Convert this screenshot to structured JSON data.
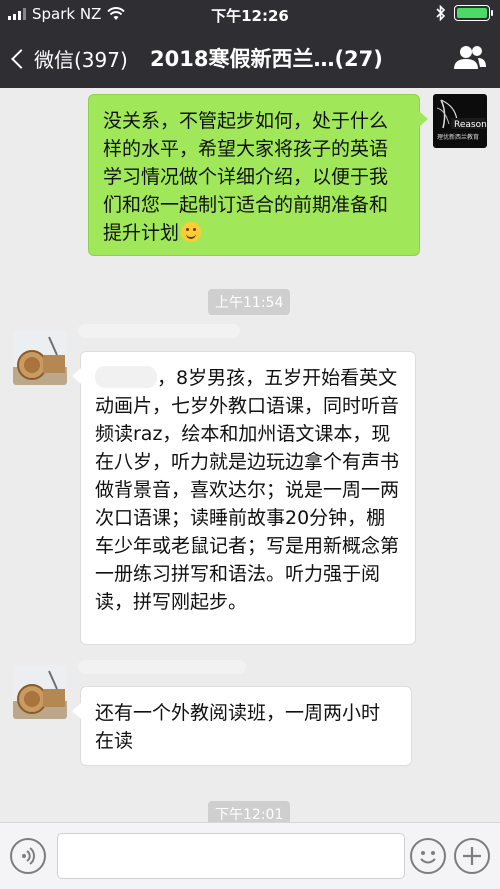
{
  "status": {
    "carrier": "Spark NZ",
    "time": "下午12:26"
  },
  "nav": {
    "back_label": "微信(397)",
    "title": "2018寒假新西兰…(27)"
  },
  "messages": {
    "m1": {
      "text": "没关系，不管起步如何，处于什么样的水平，希望大家将孩子的英语学习情况做个详细介绍，以便于我们和您一起制订适合的前期准备和提升计划"
    },
    "ts1": "上午11:54",
    "m2": {
      "text": "，8岁男孩，五岁开始看英文动画片，七岁外教口语课，同时听音频读raz，绘本和加州语文课本，现在八岁，听力就是边玩边拿个有声书做背景音，喜欢达尔；说是一周一两次口语课；读睡前故事20分钟，棚车少年或老鼠记者；写是用新概念第一册练习拼写和语法。听力强于阅读，拼写刚起步。"
    },
    "m3": {
      "text": "还有一个外教阅读班，一周两小时在读"
    },
    "ts2": "下午12:01"
  },
  "logo": {
    "text": "Reasons",
    "subtext": "理优新西兰教育"
  },
  "colors": {
    "my_bubble": "#a0e75a",
    "nav": "#2f2f33",
    "background": "#ececec"
  }
}
